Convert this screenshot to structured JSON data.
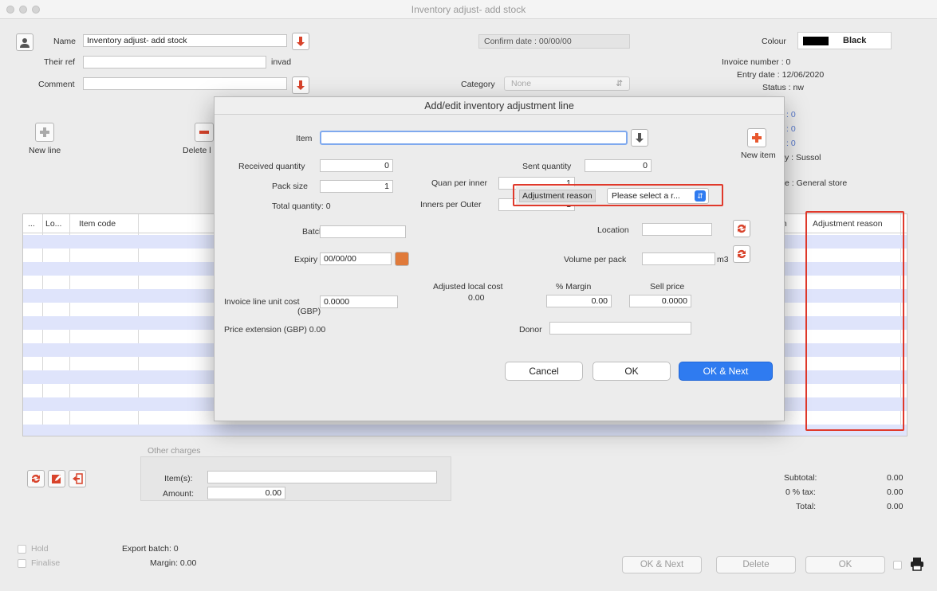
{
  "window": {
    "title": "Inventory adjust- add stock"
  },
  "header": {
    "name_label": "Name",
    "name_value": "Inventory adjust- add stock",
    "their_ref_label": "Their ref",
    "their_ref_value": "",
    "invad": "invad",
    "comment_label": "Comment",
    "comment_value": "",
    "confirm_date": "Confirm date : 00/00/00",
    "category_label": "Category",
    "category_value": "None",
    "colour_label": "Colour",
    "colour_value": "Black",
    "invoice_number": "Invoice number : 0",
    "entry_date": "Entry date : 12/06/2020",
    "status": "Status : nw",
    "side_values": [
      ": 0",
      ": 0",
      ": 0"
    ],
    "entered_by": "y : Sussol",
    "store": "e : General store"
  },
  "toolbar": {
    "new_line": "New line",
    "delete_line": "Delete l"
  },
  "grid": {
    "columns": [
      "...",
      "Lo...",
      "Item code",
      "on",
      "Adjustment reason"
    ],
    "row_count": 15
  },
  "dialog": {
    "title": "Add/edit inventory adjustment line",
    "item_label": "Item",
    "item_value": "",
    "new_item": "New item",
    "received_quantity_label": "Received quantity",
    "received_quantity": "0",
    "sent_quantity_label": "Sent quantity",
    "sent_quantity": "0",
    "pack_size_label": "Pack size",
    "pack_size": "1",
    "quan_per_inner_label": "Quan per inner",
    "quan_per_inner": "1",
    "total_quantity": "Total quantity: 0",
    "inners_per_outer_label": "Inners per Outer",
    "inners_per_outer": "1",
    "adjustment_reason_label": "Adjustment reason",
    "adjustment_reason_value": "Please select a r...",
    "batch_label": "Batch",
    "batch_value": "",
    "location_label": "Location",
    "location_value": "",
    "expiry_label": "Expiry",
    "expiry_value": "00/00/00",
    "volume_per_pack_label": "Volume per pack",
    "volume_per_pack_value": "",
    "volume_unit": "m3",
    "invoice_line_unit_cost_label": "Invoice line unit cost",
    "gbp": "(GBP)",
    "invoice_line_unit_cost": "0.0000",
    "adjusted_local_cost_label": "Adjusted local cost",
    "adjusted_local_cost": "0.00",
    "margin_label": "% Margin",
    "margin_value": "0.00",
    "sell_price_label": "Sell price",
    "sell_price": "0.0000",
    "price_extension": "Price extension (GBP)  0.00",
    "donor_label": "Donor",
    "donor_value": "",
    "cancel": "Cancel",
    "ok": "OK",
    "ok_next": "OK & Next"
  },
  "footer": {
    "other_charges": "Other charges",
    "items_label": "Item(s):",
    "items_value": "",
    "amount_label": "Amount:",
    "amount_value": "0.00",
    "subtotal_label": "Subtotal:",
    "subtotal": "0.00",
    "tax_label": "0 % tax:",
    "tax": "0.00",
    "total_label": "Total:",
    "total": "0.00",
    "hold": "Hold",
    "finalise": "Finalise",
    "export_batch": "Export batch: 0",
    "margin": "Margin: 0.00",
    "ok_next": "OK & Next",
    "delete": "Delete",
    "ok": "OK"
  },
  "colors": {
    "highlight": "#e0392b",
    "primary_button": "#2f7bf0",
    "row_stripe": "#dfe4fb",
    "colour_swatch": "#000000"
  }
}
